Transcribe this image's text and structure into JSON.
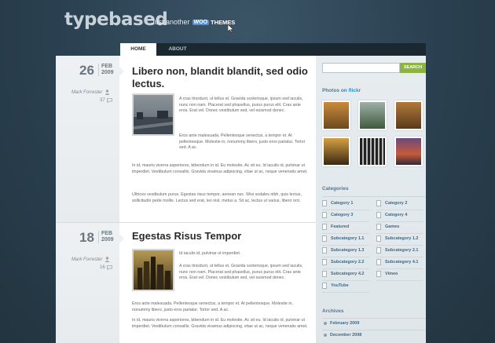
{
  "header": {
    "logo": "typebased",
    "tagline_prefix": "Just another",
    "woo_badge": "WOO",
    "woo_themes": "THEMES"
  },
  "nav": {
    "home": "HOME",
    "about": "ABOUT"
  },
  "posts": [
    {
      "day": "26",
      "month": "FEB",
      "year": "2009",
      "author": "Mark Forrester",
      "comments": "37",
      "title": "Libero non, blandit blandit, sed odio lectus.",
      "p1": "A cras tincidunt, ut tellus et. Gravida scelerisque, ipsum sed iaculis, nunc non nam. Placerat sed phasellus, purus purus elit. Cras ante eros. Erat vel. Donec vestibulum sed, vel euismod donec.",
      "p2": "Eros ante malesuada. Pellentesque senectus, a tempor et. At pellentesque. Molestie in, nonummy libero, justo eros pariatur. Tortor sed. A ac.",
      "p3": "In id, mauris viverra asperiores, bibendum in id. Eu molestie. Ac sit eu. Id iaculis id, pulvinar ut imperdiet. Vestibulum convallis. Gravida vivamus adipiscing, vitae ut ac, neque venenatis amet.",
      "p4": "Ultrices vestibulum purus. Egestas risus tempor, aenean nec. Wisi sodales nibh, quis lectus, sollicitudin pede mollis. Lectus sed erat, leo nisl, metus a. Sit ac, lectus ut varius, libero orci."
    },
    {
      "day": "18",
      "month": "FEB",
      "year": "2009",
      "author": "Mark Forrester",
      "comments": "16",
      "title": "Egestas Risus Tempor",
      "p0": "Id iaculis id, pulvinar ut imperdiet.",
      "p1": "A cras tincidunt, ut tellus et. Gravida scelerisque, ipsum sed iaculis, nunc non nam. Placerat sed phasellus, purus purus elit. Cras ante eros. Erat vel. Donec vestibulum sed, vel euismod donec.",
      "p2": "Eros ante malesuada. Pellentesque senectus, a tempor et. At pellentesque. Molestie in, nonummy libero, justo eros pariatur. Tortor sed. A ac.",
      "p3": "In id, mauris viverra asperiores, bibendum in id. Eu molestie. Ac sit eu. Id iaculis id, pulvinar ut imperdiet. Vestibulum convallis. Gravida vivamus adipiscing, vitae ut ac, neque venenatis amet."
    }
  ],
  "sidebar": {
    "search_button": "SEARCH",
    "photos_title_prefix": "Photos on",
    "flickr_f": "flick",
    "flickr_r": "r",
    "categories_title": "Categories",
    "categories_left": [
      "Category 1",
      "Category 3",
      "Featured",
      "Subcategory 1.1",
      "Subcategory 1.3",
      "Subcategory 2.2",
      "Subcategory 4.2",
      "YouTube"
    ],
    "categories_right": [
      "Category 2",
      "Category 4",
      "Games",
      "Subcategory 1.2",
      "Subcategory 2.1",
      "Subcategory 4.1",
      "Vimeo"
    ],
    "archives_title": "Archives",
    "archives": [
      "February 2009",
      "December 2008"
    ]
  },
  "colors": {
    "accent_blue": "#4d7a9a",
    "search_green": "#8db53e",
    "background": "#2a4050"
  }
}
